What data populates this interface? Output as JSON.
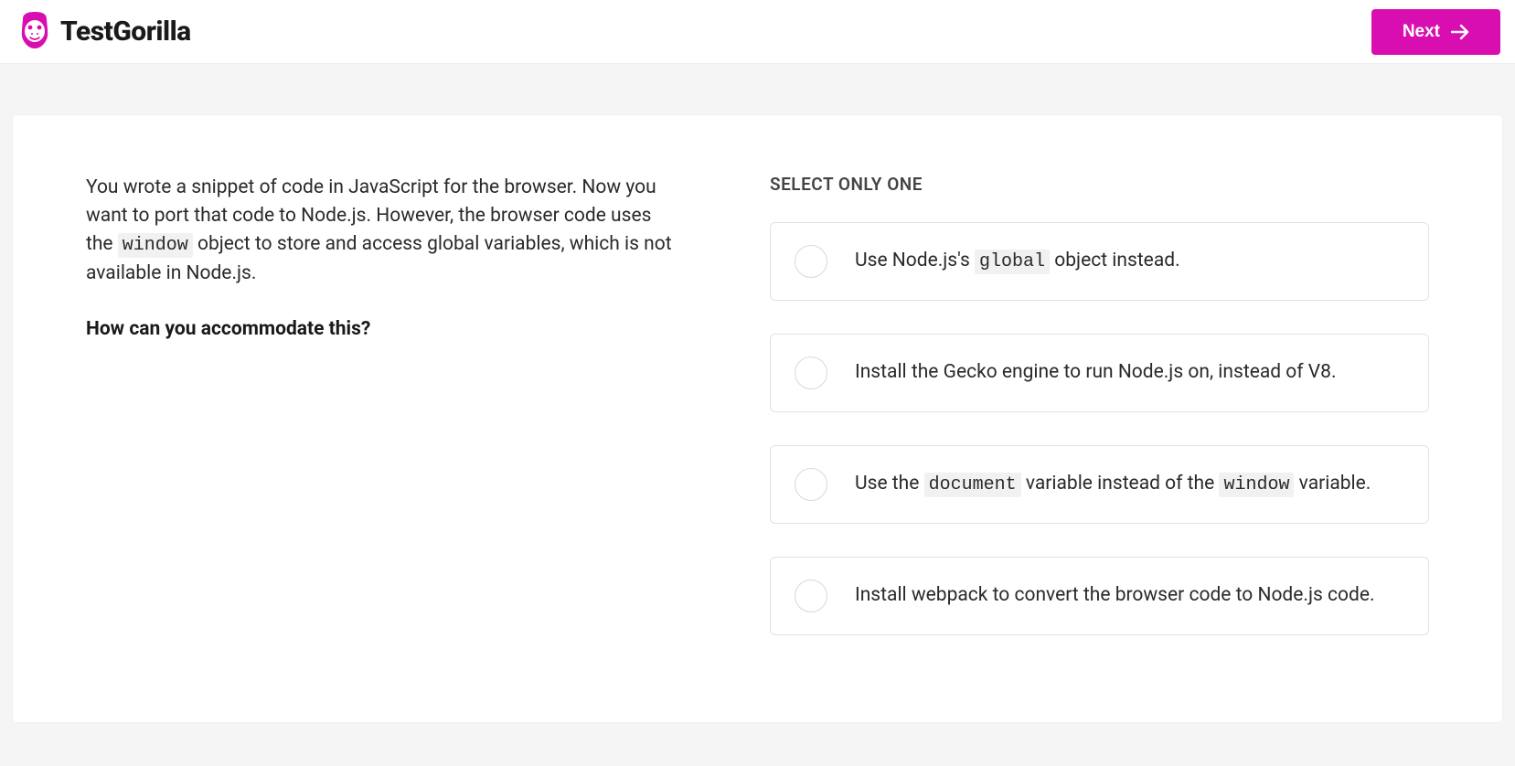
{
  "header": {
    "brand": "TestGorilla",
    "next_label": "Next"
  },
  "question": {
    "body_pre": "You wrote a snippet of code in JavaScript for the browser. Now you want to port that code to Node.js. However, the browser code uses the ",
    "code_token": "window",
    "body_post": " object to store and access global variables, which is not available in Node.js.",
    "prompt": "How can you accommodate this?"
  },
  "answers": {
    "select_title": "SELECT ONLY ONE",
    "options": [
      {
        "pre": "Use Node.js's ",
        "code": "global",
        "post": " object instead."
      },
      {
        "pre": "Install the Gecko engine to run Node.js on, instead of V8.",
        "code": "",
        "post": ""
      },
      {
        "pre": "Use the ",
        "code": "document",
        "mid": " variable instead of the ",
        "code2": "window",
        "post": " variable."
      },
      {
        "pre": "Install webpack to convert the browser code to Node.js code.",
        "code": "",
        "post": ""
      }
    ]
  }
}
